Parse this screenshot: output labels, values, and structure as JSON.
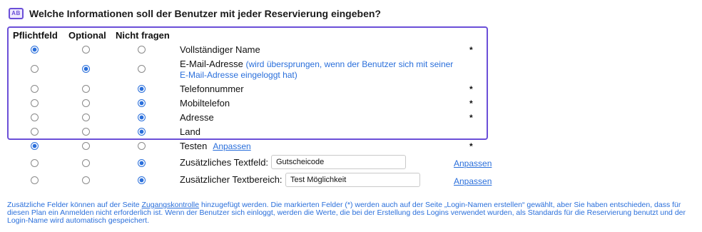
{
  "heading": {
    "icon": "form-fields-icon",
    "icon_text": "AB",
    "title": "Welche Informationen soll der Benutzer mit jeder Reservierung eingeben?"
  },
  "columns": [
    "Pflichtfeld",
    "Optional",
    "Nicht fragen"
  ],
  "fields": [
    {
      "label": "Vollständiger Name",
      "selected": "Pflichtfeld",
      "required_marker": "*"
    },
    {
      "label": "E-Mail-Adresse",
      "note_line1": "(wird übersprungen, wenn der Benutzer sich mit seiner",
      "note_line2": "E-Mail-Adresse eingeloggt hat)",
      "selected": "Optional",
      "required_marker": ""
    },
    {
      "label": "Telefonnummer",
      "selected": "Nicht fragen",
      "required_marker": "*"
    },
    {
      "label": "Mobiltelefon",
      "selected": "Nicht fragen",
      "required_marker": "*"
    },
    {
      "label": "Adresse",
      "selected": "Nicht fragen",
      "required_marker": "*"
    },
    {
      "label": "Land",
      "selected": "Nicht fragen",
      "required_marker": ""
    },
    {
      "label": "Testen",
      "link": "Anpassen",
      "selected": "Pflichtfeld",
      "required_marker": "*"
    },
    {
      "label": "Zusätzliches Textfeld:",
      "input_value": "Gutscheicode",
      "link": "Anpassen",
      "selected": "Nicht fragen",
      "required_marker": ""
    },
    {
      "label": "Zusätzlicher Textbereich:",
      "input_value": "Test Möglichkeit",
      "link": "Anpassen",
      "selected": "Nicht fragen",
      "required_marker": ""
    }
  ],
  "footer": {
    "text_before_link": "Zusätzliche Felder können auf der Seite ",
    "link": "Zugangskontrolle",
    "text_after_link": " hinzugefügt werden. Die markierten Felder (*) werden auch auf der Seite „Login-Namen erstellen“ gewählt, aber Sie haben entschieden, dass für diesen Plan ein Anmelden nicht erforderlich ist. Wenn der Benutzer sich einloggt, werden die Werte, die bei der Erstellung des Logins verwendet wurden, als Standards für die Reservierung benutzt und der Login-Name wird automatisch gespeichert."
  },
  "colors": {
    "accent": "#6b4fd8",
    "link": "#2a6fdb",
    "radio_checked": "#2a6fdb"
  }
}
